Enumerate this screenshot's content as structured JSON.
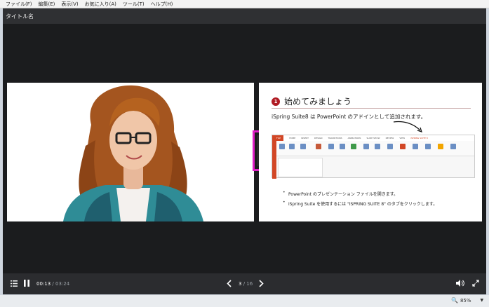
{
  "menu": [
    "ファイル(F)",
    "編集(E)",
    "表示(V)",
    "お気に入り(A)",
    "ツール(T)",
    "ヘルプ(H)"
  ],
  "player": {
    "title": "タイトル名"
  },
  "slide": {
    "number": "1",
    "heading": "始めてみましょう",
    "subtitle": "iSpring Suite8 は PowerPoint のアドインとして追加されます。",
    "ppt_tabs": [
      "FILE",
      "HOME",
      "INSERT",
      "DESIGN",
      "TRANSITIONS",
      "ANIMATIONS",
      "SLIDE SHOW",
      "REVIEW",
      "VIEW",
      "iSPRING SUITE 8"
    ],
    "bullets": [
      "PowerPoint のプレゼンテーション ファイルを開きます。",
      "iSpring Suite を使用するには \"ISPRING SUITE 8\" のタブをクリックします。"
    ]
  },
  "controls": {
    "time_current": "00:13",
    "time_sep": " / ",
    "time_total": "03:24",
    "slide_current": "3",
    "slide_sep": " / ",
    "slide_total": "16",
    "progress": 0.065
  },
  "status": {
    "zoom": "85%"
  },
  "colors": {
    "accent": "#f2a500",
    "highlight_border": "#e01ec6",
    "badge": "#b01b23"
  },
  "icons": {
    "list": "list-icon",
    "pause": "pause-icon",
    "prev": "chevron-left-icon",
    "next": "chevron-right-icon",
    "volume": "volume-icon",
    "fullscreen": "fullscreen-icon",
    "zoom": "zoom-icon"
  }
}
